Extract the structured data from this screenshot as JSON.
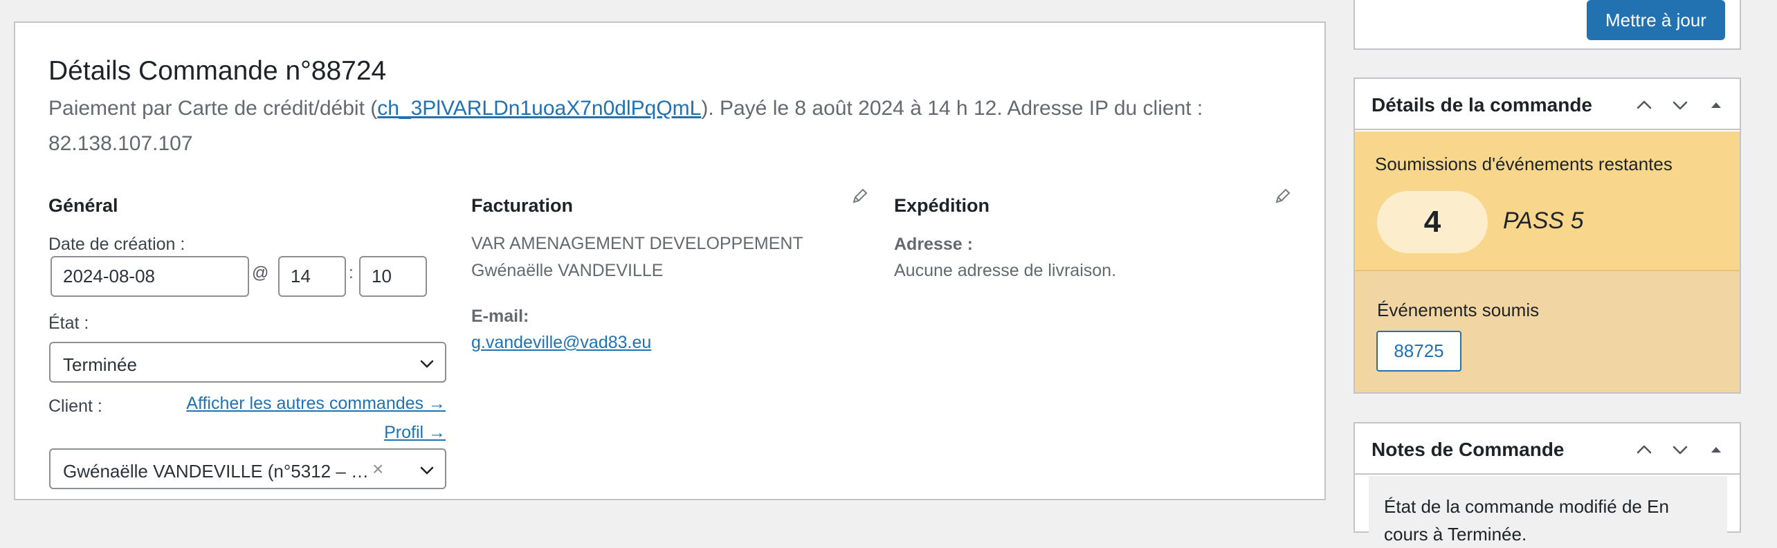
{
  "order": {
    "title": "Détails Commande n°88724",
    "payment_prefix": "Paiement par Carte de crédit/débit (",
    "charge_id": "ch_3PlVARLDn1uoaX7n0dlPqQmL",
    "payment_suffix": "). Payé le 8 août 2024 à 14 h 12. Adresse IP du client : 82.138.107.107"
  },
  "general": {
    "title": "Général",
    "creation_date_label": "Date de création :",
    "date_value": "2024-08-08",
    "at_sign": "@",
    "hour_value": "14",
    "time_sep": ":",
    "minute_value": "10",
    "status_label": "État :",
    "status_value": "Terminée",
    "client_label": "Client :",
    "other_orders_link": "Afficher les autres commandes →",
    "profile_link": "Profil →",
    "client_value": "Gwénaëlle VANDEVILLE (n°5312 – …",
    "clear_glyph": "×"
  },
  "billing": {
    "title": "Facturation",
    "company": "VAR AMENAGEMENT DEVELOPPEMENT",
    "name": "Gwénaëlle VANDEVILLE",
    "email_label": "E-mail:",
    "email": "g.vandeville@vad83.eu"
  },
  "shipping": {
    "title": "Expédition",
    "address_label": "Adresse :",
    "address_value": "Aucune adresse de livraison."
  },
  "sidebar": {
    "update_button": "Mettre à jour",
    "details_title": "Détails de la commande",
    "remaining_label": "Soumissions d'événements restantes",
    "remaining_count": "4",
    "pass_label": "PASS 5",
    "submitted_label": "Événements soumis",
    "submitted_id": "88725",
    "notes_title": "Notes de Commande",
    "note_text": "État de la commande modifié de En cours à Terminée."
  },
  "colors": {
    "accent": "#2271b1",
    "remaining_bg": "#f8d68c",
    "submitted_bg": "#f1d6a3"
  },
  "icons": [
    "pencil-icon",
    "chevron-down-icon",
    "chevron-up-icon",
    "triangle-up-icon",
    "clear-icon"
  ]
}
